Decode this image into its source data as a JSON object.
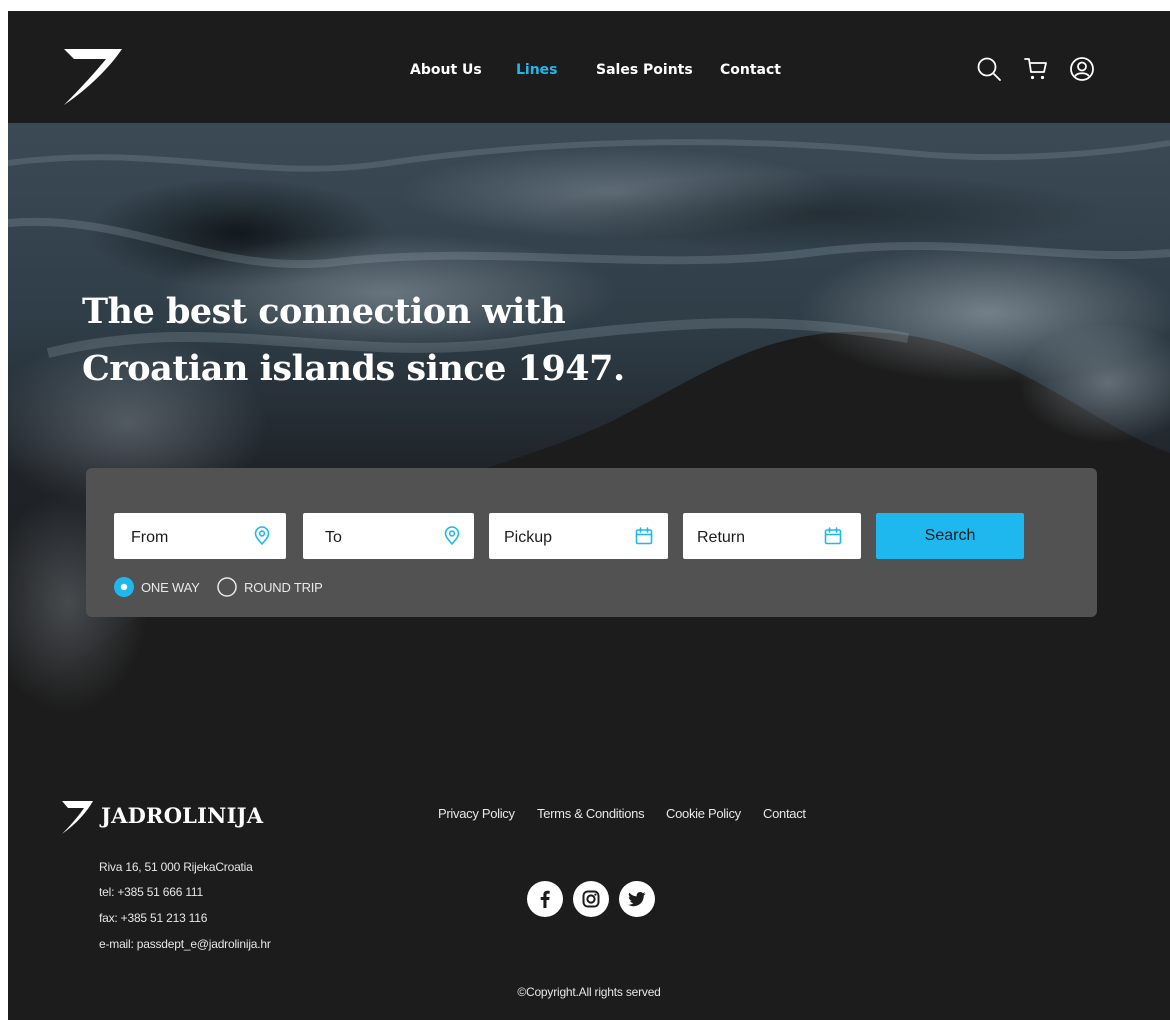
{
  "header": {
    "logo_icon": "swoosh-logo-icon",
    "nav": [
      {
        "label": "About Us",
        "active": false
      },
      {
        "label": "Lines",
        "active": true
      },
      {
        "label": "Sales Points",
        "active": false
      },
      {
        "label": "Contact",
        "active": false
      }
    ],
    "icons": [
      "search-icon",
      "cart-icon",
      "user-icon"
    ]
  },
  "hero": {
    "headline_line1": "The best connection with",
    "headline_line2": "Croatian islands since 1947."
  },
  "search": {
    "from_label": "From",
    "to_label": "To",
    "pickup_label": "Pickup",
    "return_label": "Return",
    "button_label": "Search",
    "trip_options": [
      {
        "label": "ONE WAY",
        "selected": true
      },
      {
        "label": "ROUND TRIP",
        "selected": false
      }
    ]
  },
  "footer": {
    "brand": "JADROLINIJA",
    "address": "Riva 16, 51 000 RijekaCroatia",
    "tel": "tel: +385 51 666 111",
    "fax": "fax: +385 51 213 116",
    "email": "e-mail: passdept_e@jadrolinija.hr",
    "links": [
      "Privacy Policy",
      "Terms & Conditions",
      "Cookie Policy",
      "Contact"
    ],
    "social": [
      "facebook-icon",
      "instagram-icon",
      "twitter-icon"
    ],
    "copyright": "©Copyright.All rights served"
  },
  "colors": {
    "background": "#1c1c1c",
    "accent": "#1fb8ee",
    "panel": "#525252",
    "text": "#ffffff"
  }
}
